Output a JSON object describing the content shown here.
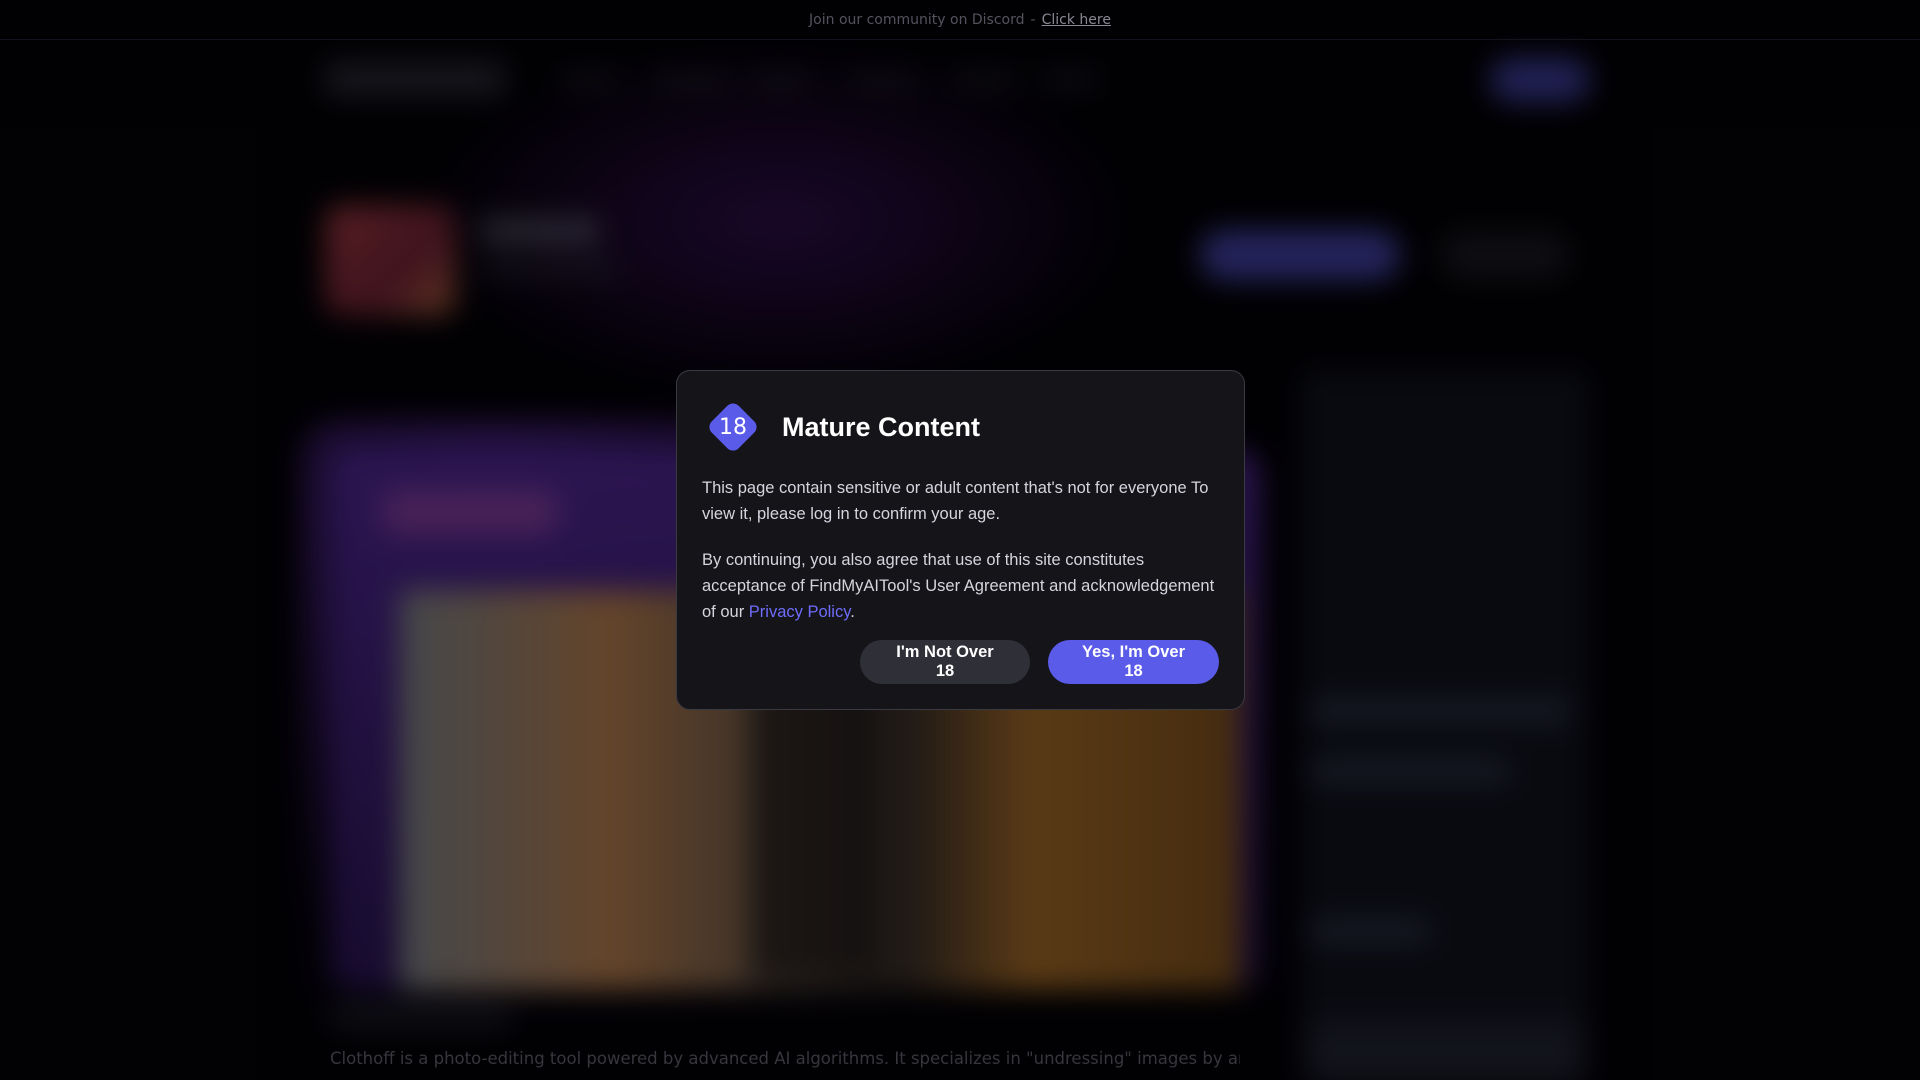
{
  "announcement": {
    "text": "Join our community on Discord",
    "separator": "-",
    "link_label": "Click here"
  },
  "tool_description": "Clothoff is a photo-editing tool powered by advanced AI algorithms. It specializes in \"undressing\" images by analyzing and",
  "modal": {
    "badge": "18",
    "title": "Mature Content",
    "paragraph1": "This page contain sensitive or adult content that's not for everyone To view it, please log in to confirm your age.",
    "paragraph2_before": "By continuing, you also agree that use of this site constitutes acceptance of FindMyAITool's User Agreement and acknowledgement of our ",
    "privacy_link": "Privacy Policy",
    "paragraph2_after": ".",
    "decline_label": "I'm Not Over 18",
    "accept_label": "Yes, I'm Over 18"
  },
  "colors": {
    "accent": "#5b5bea",
    "link": "#6f6dfb",
    "modal_bg": "#141419",
    "page_bg": "#030206"
  },
  "icons": {
    "age_badge": "diamond-18-icon"
  }
}
